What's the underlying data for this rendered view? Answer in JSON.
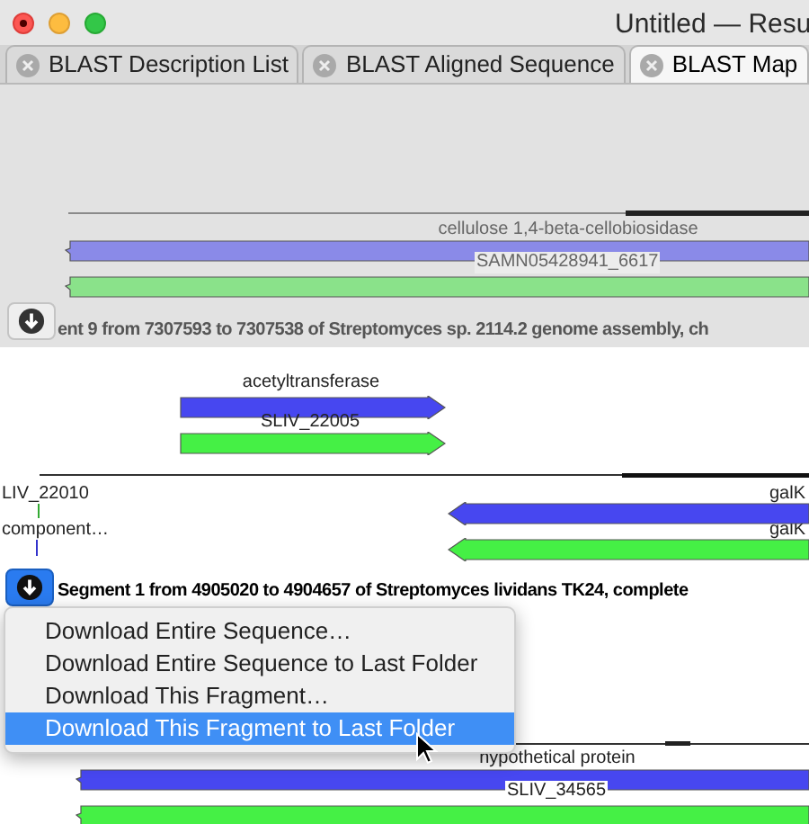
{
  "window": {
    "title": "Untitled — Resu"
  },
  "tabs": [
    {
      "label": "BLAST Description List",
      "selected": false
    },
    {
      "label": "BLAST Aligned Sequence",
      "selected": false
    },
    {
      "label": "BLAST Map",
      "selected": true
    }
  ],
  "map": {
    "upper_segment": {
      "dimmed": true,
      "download_pressed": false,
      "protein_label": "cellulose 1,4-beta-cellobiosidase",
      "gene_label": "SAMN05428941_6617",
      "caption": "ent 9 from 7307593 to 7307538 of Streptomyces sp. 2114.2 genome assembly, ch"
    },
    "active_segment": {
      "download_pressed": true,
      "protein_label": "acetyltransferase",
      "gene_label": "SLIV_22005",
      "left_labels": [
        "LIV_22010",
        "component…"
      ],
      "right_labels": [
        "galK",
        "galK"
      ],
      "caption": "Segment 1 from 4905020 to 4904657 of Streptomyces lividans TK24, complete"
    },
    "lower_segment": {
      "protein_label": "hypothetical protein",
      "gene_label": "SLIV_34565"
    }
  },
  "menu": {
    "items": [
      {
        "label": "Download Entire Sequence…",
        "selected": false
      },
      {
        "label": "Download Entire Sequence to Last Folder",
        "selected": false
      },
      {
        "label": "Download This Fragment…",
        "selected": false
      },
      {
        "label": "Download This Fragment to Last Folder",
        "selected": true
      }
    ]
  }
}
